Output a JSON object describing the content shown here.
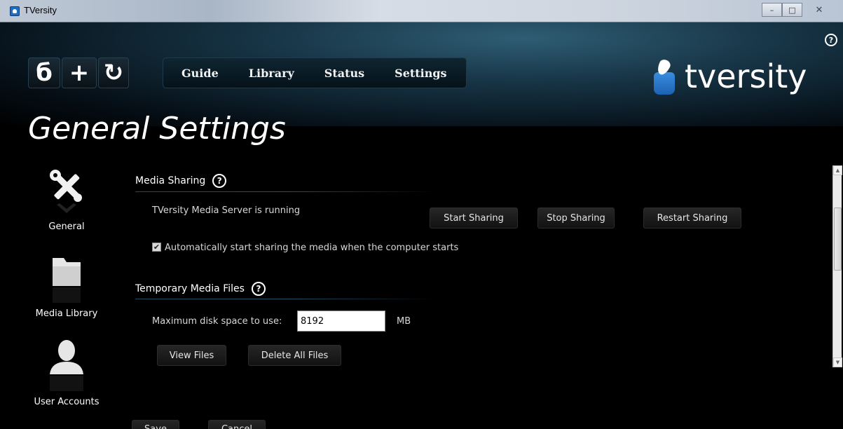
{
  "window": {
    "title": "TVersity",
    "minimize": "–",
    "maximize": "□",
    "close": "✕"
  },
  "header": {
    "help": "?",
    "quick_buttons": [
      {
        "icon": "power-icon",
        "glyph": "б"
      },
      {
        "icon": "add-icon",
        "glyph": "+"
      },
      {
        "icon": "refresh-icon",
        "glyph": "↻"
      }
    ],
    "nav": [
      "Guide",
      "Library",
      "Status",
      "Settings"
    ],
    "brand": "tversity"
  },
  "page_title": "General Settings",
  "sidebar": {
    "items": [
      {
        "label": "General",
        "icon": "tools-icon"
      },
      {
        "label": "Media Library",
        "icon": "folder-icon"
      },
      {
        "label": "User Accounts",
        "icon": "user-icon"
      }
    ]
  },
  "media_sharing": {
    "title": "Media Sharing",
    "help": "?",
    "status": "TVersity Media Server is running",
    "start_label": "Start Sharing",
    "stop_label": "Stop Sharing",
    "restart_label": "Restart Sharing",
    "auto_start_checked": true,
    "auto_start_label": "Automatically start sharing the media when the computer starts"
  },
  "temp_files": {
    "title": "Temporary Media Files",
    "help": "?",
    "max_disk_label": "Maximum disk space to use:",
    "max_disk_value": "8192",
    "unit": "MB",
    "view_label": "View Files",
    "delete_label": "Delete All Files"
  },
  "footer": {
    "save_label": "Save",
    "cancel_label": "Cancel"
  }
}
